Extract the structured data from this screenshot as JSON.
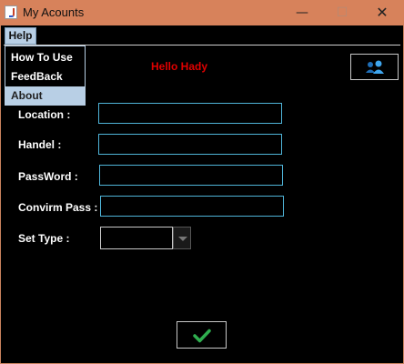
{
  "window": {
    "title": "My Acounts",
    "min_glyph": "—",
    "max_glyph": "☐",
    "close_glyph": "✕"
  },
  "menu": {
    "help_label": "Help",
    "items": [
      {
        "label": "How To Use"
      },
      {
        "label": "FeedBack"
      },
      {
        "label": "About",
        "selected": true
      }
    ]
  },
  "greeting": "Hello Hady",
  "form": {
    "location_label": "Location :",
    "location_value": "",
    "handel_label": "Handel :",
    "handel_value": "",
    "password_label": "PassWord :",
    "password_value": "",
    "confirm_label": "Convirm Pass :",
    "confirm_value": "",
    "type_label": "Set Type :",
    "type_value": ""
  },
  "icons": {
    "users": "users-icon",
    "submit": "checkmark-icon"
  },
  "colors": {
    "titlebar": "#d7825b",
    "field_border": "#4fb4d8",
    "greeting": "#e00000",
    "check": "#2fae4f",
    "menu_highlight": "#b8cfe5"
  }
}
